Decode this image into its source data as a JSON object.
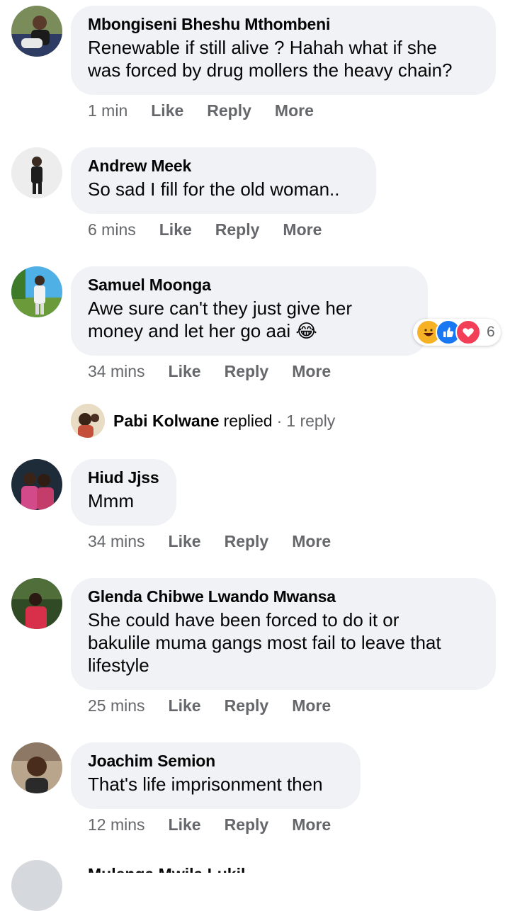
{
  "comments": [
    {
      "author": "Mbongiseni Bheshu Mthombeni",
      "text": "Renewable if still alive ? Hahah what if she\nwas forced by drug mollers the heavy chain?",
      "time": "1 min",
      "actions": [
        "Like",
        "Reply",
        "More"
      ]
    },
    {
      "author": "Andrew Meek",
      "text": "So sad I fill for the old woman..",
      "time": "6 mins",
      "actions": [
        "Like",
        "Reply",
        "More"
      ]
    },
    {
      "author": "Samuel Moonga",
      "text": "Awe sure can't they just give her\nmoney and let her go aai 😂",
      "time": "34 mins",
      "actions": [
        "Like",
        "Reply",
        "More"
      ],
      "reactions": {
        "icons": [
          "haha-icon",
          "like-icon",
          "love-icon"
        ],
        "count": "6"
      }
    },
    {
      "author": "Hiud Jjss",
      "text": "Mmm",
      "time": "34 mins",
      "actions": [
        "Like",
        "Reply",
        "More"
      ]
    },
    {
      "author": "Glenda Chibwe Lwando Mwansa",
      "text": "She could have been forced to do it or\nbakulile muma gangs most fail to leave that\nlifestyle",
      "time": "25 mins",
      "actions": [
        "Like",
        "Reply",
        "More"
      ]
    },
    {
      "author": "Joachim Semion",
      "text": "That's life imprisonment then",
      "time": "12 mins",
      "actions": [
        "Like",
        "Reply",
        "More"
      ]
    }
  ],
  "replied": {
    "name": "Pabi Kolwane",
    "verb": "replied",
    "separator": "·",
    "count": "1 reply"
  },
  "partial": {
    "author": "Mulenga Mwila Lukil"
  },
  "colors": {
    "bubble": "#f0f2f5",
    "meta": "#65676b",
    "like": "#1877f2",
    "love": "#f33e58",
    "haha": "#f7b125"
  }
}
